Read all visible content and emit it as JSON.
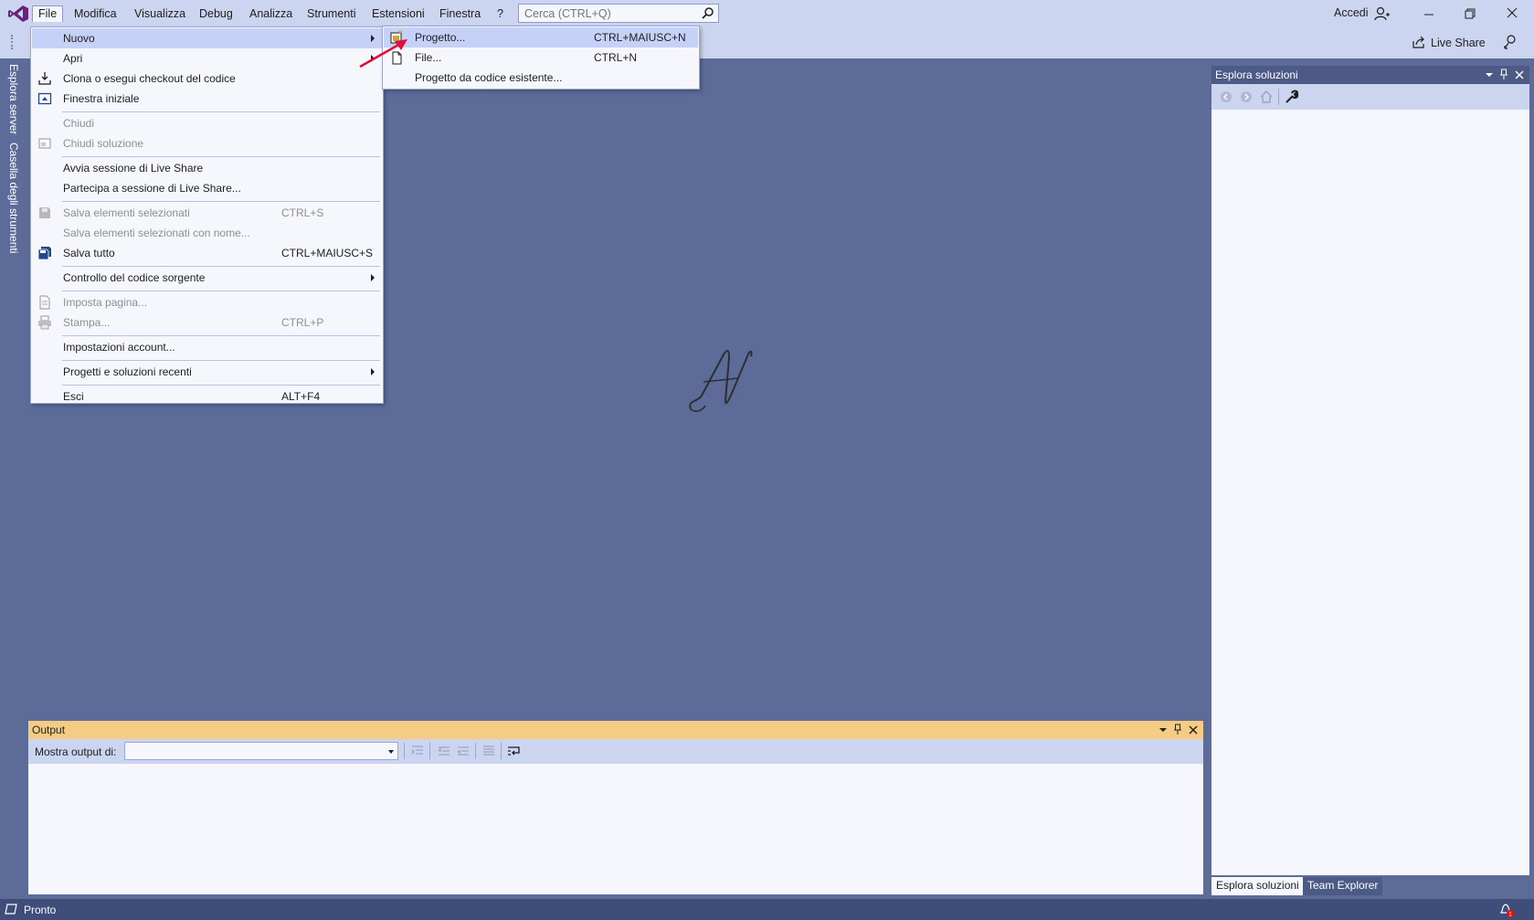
{
  "menubar": {
    "items": [
      "File",
      "Modifica",
      "Visualizza",
      "Debug",
      "Analizza",
      "Strumenti",
      "Estensioni",
      "Finestra",
      "?"
    ],
    "search_placeholder": "Cerca (CTRL+Q)",
    "signin_label": "Accedi"
  },
  "toolbar": {
    "liveshare_label": "Live Share"
  },
  "left_tabs": [
    "Esplora server",
    "Casella degli strumenti"
  ],
  "file_menu": {
    "nuovo": "Nuovo",
    "apri": "Apri",
    "clona": "Clona o esegui checkout del codice",
    "finestra_iniziale": "Finestra iniziale",
    "chiudi": "Chiudi",
    "chiudi_soluzione": "Chiudi soluzione",
    "avvia_live_share": "Avvia sessione di Live Share",
    "partecipa_live_share": "Partecipa a sessione di Live Share...",
    "salva_selezionati": "Salva elementi selezionati",
    "salva_selezionati_sc": "CTRL+S",
    "salva_con_nome": "Salva elementi selezionati con nome...",
    "salva_tutto": "Salva tutto",
    "salva_tutto_sc": "CTRL+MAIUSC+S",
    "controllo_codice": "Controllo del codice sorgente",
    "imposta_pagina": "Imposta pagina...",
    "stampa": "Stampa...",
    "stampa_sc": "CTRL+P",
    "impostazioni_account": "Impostazioni account...",
    "recenti": "Progetti e soluzioni recenti",
    "esci": "Esci",
    "esci_sc": "ALT+F4"
  },
  "new_submenu": {
    "progetto": "Progetto...",
    "progetto_sc": "CTRL+MAIUSC+N",
    "file": "File...",
    "file_sc": "CTRL+N",
    "da_codice": "Progetto da codice esistente..."
  },
  "solution_explorer": {
    "title": "Esplora soluzioni",
    "tab_solution": "Esplora soluzioni",
    "tab_team": "Team Explorer"
  },
  "output": {
    "title": "Output",
    "show_label": "Mostra output di:",
    "selected": ""
  },
  "status": {
    "text": "Pronto"
  },
  "colors": {
    "accent": "#68217a",
    "background": "#5d6b99",
    "chrome": "#ccd5f0",
    "output_header": "#f5cc84",
    "annotation_arrow": "#e0103a"
  }
}
